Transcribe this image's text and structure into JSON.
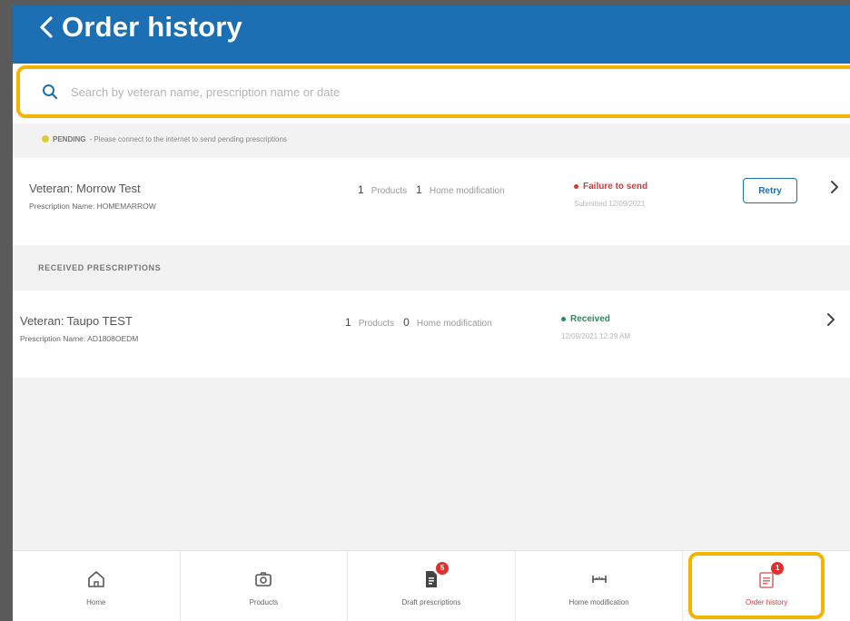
{
  "header": {
    "title": "Order history"
  },
  "search": {
    "placeholder": "Search by veteran name, prescription name or date"
  },
  "pending": {
    "label": "PENDING",
    "message": "- Please connect to the internet to send pending prescriptions"
  },
  "pending_orders": [
    {
      "veteran": "Veteran: Morrow Test",
      "prescription": "Prescription Name: HOMEMARROW",
      "products_count": "1",
      "products_label": "Products",
      "mods_count": "1",
      "mods_label": "Home modification",
      "status": "Failure to send",
      "status_sub": "Submitted 12/09/2021",
      "retry_label": "Retry"
    }
  ],
  "received_section": {
    "title": "RECEIVED PRESCRIPTIONS"
  },
  "received_orders": [
    {
      "veteran": "Veteran: Taupo TEST",
      "prescription": "Prescription Name: AD1808OEDM",
      "products_count": "1",
      "products_label": "Products",
      "mods_count": "0",
      "mods_label": "Home modification",
      "status": "Received",
      "status_sub": "12/09/2021 12:29 AM"
    }
  ],
  "tabbar": {
    "tabs": [
      {
        "label": "Home",
        "icon": "home-icon"
      },
      {
        "label": "Products",
        "icon": "camera-icon"
      },
      {
        "label": "Draft prescriptions",
        "icon": "document-icon",
        "badge": "5"
      },
      {
        "label": "Home modification",
        "icon": "ruler-icon"
      },
      {
        "label": "Order history",
        "icon": "history-icon",
        "badge": "1",
        "active": true
      }
    ]
  },
  "colors": {
    "header": "#1b6fb2",
    "highlight": "#f5b400",
    "failure": "#d63b3b",
    "received": "#2e8b57",
    "badge": "#e0302e"
  }
}
